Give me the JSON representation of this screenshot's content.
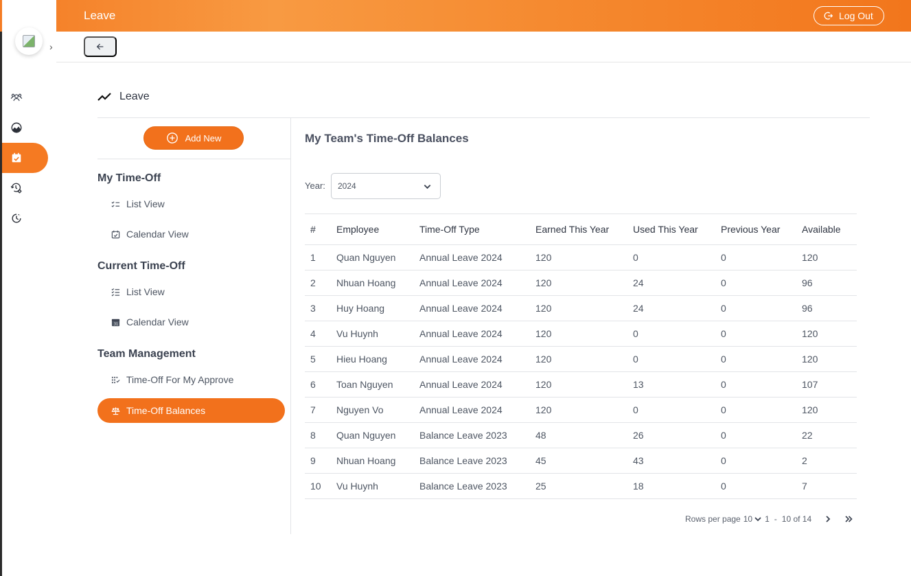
{
  "header": {
    "title": "Leave",
    "logout_label": "Log Out"
  },
  "rail": {
    "items": [
      {
        "icon": "team-icon",
        "active": false
      },
      {
        "icon": "dashboard-icon",
        "active": false
      },
      {
        "icon": "calendar-check-icon",
        "active": true
      },
      {
        "icon": "history-settings-icon",
        "active": false
      },
      {
        "icon": "clock-history-icon",
        "active": false
      }
    ]
  },
  "page": {
    "heading": "Leave"
  },
  "left_menu": {
    "add_new_label": "Add New",
    "sections": [
      {
        "title": "My Time-Off",
        "items": [
          "List View",
          "Calendar View"
        ]
      },
      {
        "title": "Current Time-Off",
        "items": [
          "List View",
          "Calendar View"
        ]
      },
      {
        "title": "Team Management",
        "items": [
          "Time-Off For My Approve",
          "Time-Off Balances"
        ]
      }
    ],
    "active_item": "Time-Off Balances"
  },
  "content": {
    "title": "My Team's Time-Off Balances",
    "year_label": "Year:",
    "year_value": "2024"
  },
  "table": {
    "columns": [
      "#",
      "Employee",
      "Time-Off Type",
      "Earned This Year",
      "Used This Year",
      "Previous Year",
      "Available"
    ],
    "rows": [
      [
        "1",
        "Quan Nguyen",
        "Annual Leave 2024",
        "120",
        "0",
        "0",
        "120"
      ],
      [
        "2",
        "Nhuan Hoang",
        "Annual Leave 2024",
        "120",
        "24",
        "0",
        "96"
      ],
      [
        "3",
        "Huy Hoang",
        "Annual Leave 2024",
        "120",
        "24",
        "0",
        "96"
      ],
      [
        "4",
        "Vu Huynh",
        "Annual Leave 2024",
        "120",
        "0",
        "0",
        "120"
      ],
      [
        "5",
        "Hieu Hoang",
        "Annual Leave 2024",
        "120",
        "0",
        "0",
        "120"
      ],
      [
        "6",
        "Toan Nguyen",
        "Annual Leave 2024",
        "120",
        "13",
        "0",
        "107"
      ],
      [
        "7",
        "Nguyen Vo",
        "Annual Leave 2024",
        "120",
        "0",
        "0",
        "120"
      ],
      [
        "8",
        "Quan Nguyen",
        "Balance Leave 2023",
        "48",
        "26",
        "0",
        "22"
      ],
      [
        "9",
        "Nhuan Hoang",
        "Balance Leave 2023",
        "45",
        "43",
        "0",
        "2"
      ],
      [
        "10",
        "Vu Huynh",
        "Balance Leave 2023",
        "25",
        "18",
        "0",
        "7"
      ]
    ]
  },
  "pagination": {
    "rows_per_page_label": "Rows per page",
    "rows_per_page_value": "10",
    "range_start": "1",
    "range_sep": "-",
    "range_text": "10 of 14"
  },
  "colors": {
    "accent": "#f2711c",
    "header_start": "#f47c24",
    "header_end": "#f2761c"
  }
}
